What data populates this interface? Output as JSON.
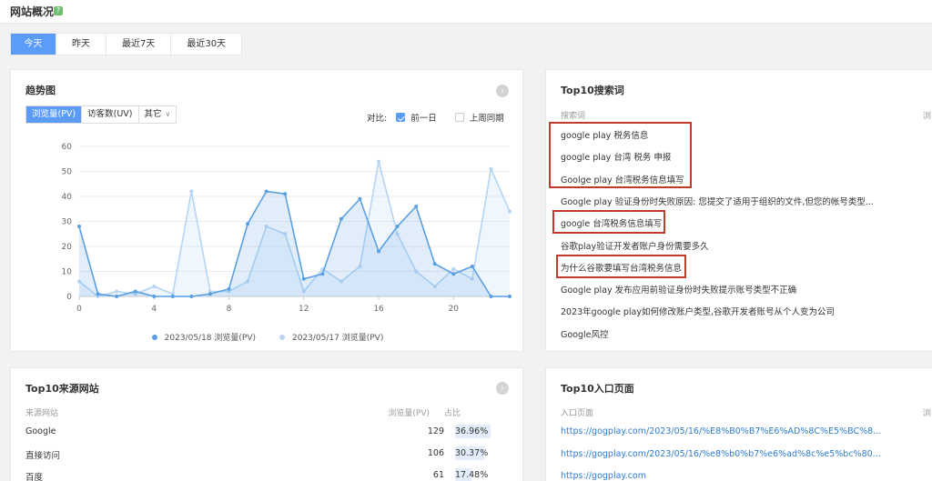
{
  "header": {
    "title": "网站概况",
    "help_icon": "question-icon"
  },
  "date_tabs": [
    {
      "label": "今天",
      "active": true
    },
    {
      "label": "昨天",
      "active": false
    },
    {
      "label": "最近7天",
      "active": false
    },
    {
      "label": "最近30天",
      "active": false
    }
  ],
  "trend": {
    "title": "趋势图",
    "metric_tabs": [
      "浏览量(PV)",
      "访客数(UV)",
      "其它"
    ],
    "compare_label": "对比:",
    "compare_options": [
      {
        "label": "前一日",
        "checked": true
      },
      {
        "label": "上周同期",
        "checked": false
      }
    ]
  },
  "chart_data": {
    "type": "area",
    "x": [
      0,
      1,
      2,
      3,
      4,
      5,
      6,
      7,
      8,
      9,
      10,
      11,
      12,
      13,
      14,
      15,
      16,
      17,
      18,
      19,
      20,
      21,
      22,
      23
    ],
    "x_ticks": [
      0,
      4,
      8,
      12,
      16,
      20
    ],
    "y_ticks": [
      0,
      10,
      20,
      30,
      40,
      50,
      60
    ],
    "ylim": [
      0,
      60
    ],
    "xlim": [
      0,
      23
    ],
    "grid": true,
    "legend_position": "bottom",
    "series": [
      {
        "name": "2023/05/18 浏览量(PV)",
        "color": "#5b9fe3",
        "values": [
          28,
          1,
          0,
          2,
          0,
          0,
          0,
          1,
          3,
          29,
          42,
          41,
          7,
          9,
          31,
          39,
          18,
          28,
          36,
          13,
          9,
          12,
          0,
          0
        ]
      },
      {
        "name": "2023/05/17 浏览量(PV)",
        "color": "#b5d5f5",
        "values": [
          6,
          0,
          2,
          1,
          4,
          1,
          42,
          2,
          2,
          6,
          28,
          25,
          2,
          11,
          6,
          12,
          54,
          25,
          10,
          4,
          11,
          7,
          51,
          34
        ]
      }
    ]
  },
  "search": {
    "title": "Top10搜索词",
    "col_keyword": "搜索词",
    "col_other": "浏",
    "keywords": [
      "google play 税务信息",
      "google play 台湾 税务 申报",
      "Goolge play 台湾税务信息填写",
      "Google play 验证身份时失败原因: 您提交了适用于组织的文件,但您的帐号类型...",
      "google 台湾税务信息填写",
      "谷歌play验证开发者账户身份需要多久",
      "为什么谷歌要填写台湾税务信息",
      "Google play 发布应用前验证身份时失败提示账号类型不正确",
      "2023年google play如何修改账户类型,谷歌开发者账号从个人变为公司",
      "Google风控"
    ]
  },
  "sources": {
    "title": "Top10来源网站",
    "col_site": "来源网站",
    "col_views": "浏览量(PV)",
    "col_ratio": "占比",
    "rows": [
      {
        "name": "Google",
        "views": "129",
        "ratio": "36.96%",
        "pct": 36.96
      },
      {
        "name": "直接访问",
        "views": "106",
        "ratio": "30.37%",
        "pct": 30.37
      },
      {
        "name": "百度",
        "views": "61",
        "ratio": "17.48%",
        "pct": 17.48
      }
    ]
  },
  "landing": {
    "title": "Top10入口页面",
    "col_page": "入口页面",
    "col_other": "浏",
    "links": [
      "https://gogplay.com/2023/05/16/%E8%B0%B7%E6%AD%8C%E5%BC%8...",
      "https://gogplay.com/2023/05/16/%e8%b0%b7%e6%ad%8c%e5%bc%80...",
      "https://gogplay.com"
    ]
  }
}
